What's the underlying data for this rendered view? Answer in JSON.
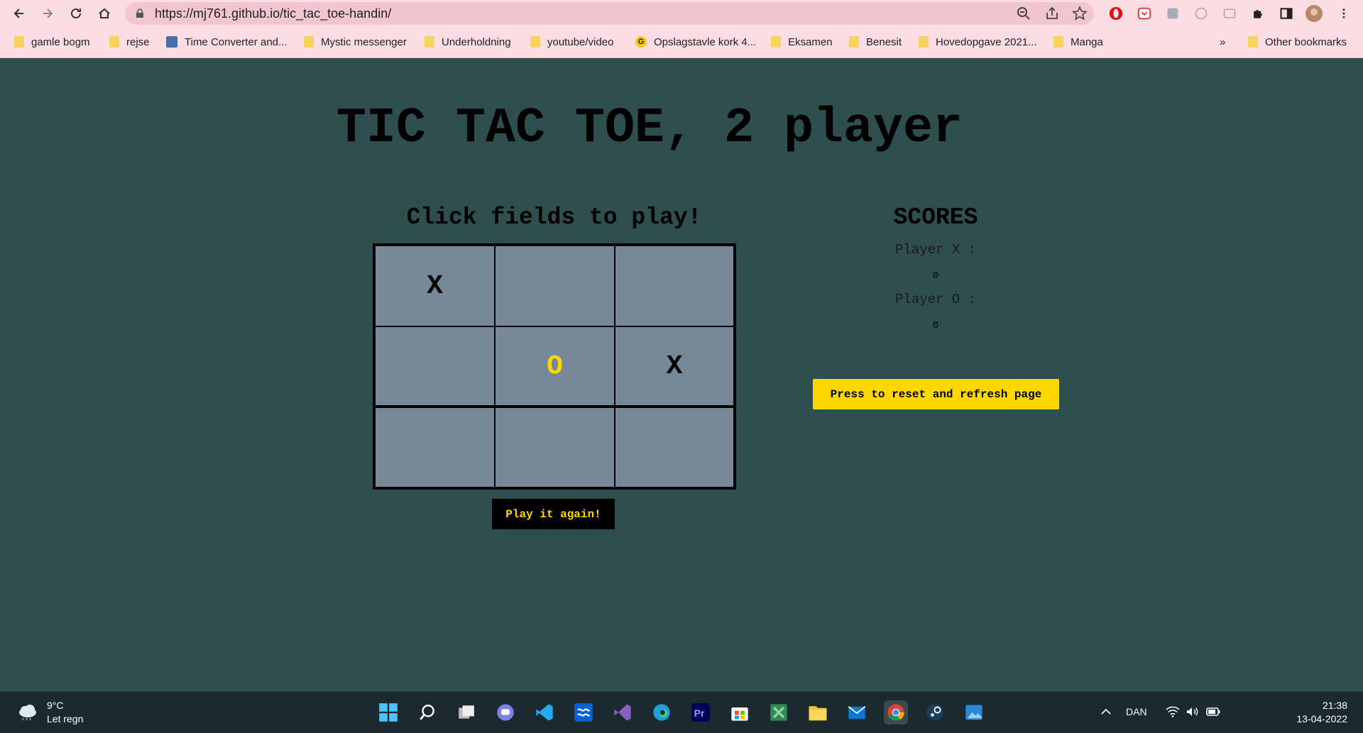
{
  "browser": {
    "url": "https://mj761.github.io/tic_tac_toe-handin/",
    "bookmarks": [
      {
        "label": "gamle bogm",
        "icon": "folder-icon"
      },
      {
        "label": "rejse",
        "icon": "folder-icon"
      },
      {
        "label": "Time Converter and...",
        "icon": "clock-site-icon"
      },
      {
        "label": "Mystic messenger",
        "icon": "folder-icon"
      },
      {
        "label": "Underholdning",
        "icon": "folder-icon"
      },
      {
        "label": "youtube/video",
        "icon": "folder-icon"
      },
      {
        "label": "Opslagstavle kork 4...",
        "icon": "g-site-icon"
      },
      {
        "label": "Eksamen",
        "icon": "folder-icon"
      },
      {
        "label": "Benesit",
        "icon": "folder-icon"
      },
      {
        "label": "Hovedopgave 2021...",
        "icon": "folder-icon"
      },
      {
        "label": "Manga",
        "icon": "folder-icon"
      }
    ],
    "overflow_label": "»",
    "other_bookmarks": "Other bookmarks"
  },
  "game": {
    "title": "TIC TAC TOE, 2 player",
    "instructions": "Click fields to play!",
    "board": [
      "X",
      "",
      "",
      "",
      "O",
      "X",
      "",
      "",
      ""
    ],
    "x_color": "#000000",
    "o_color": "#ffd700",
    "play_again_label": "Play it again!"
  },
  "scores": {
    "title": "SCORES",
    "player_x_label": "Player X :",
    "player_x_score": "0",
    "player_o_label": "Player O :",
    "player_o_score": "0",
    "reset_label": "Press to reset and refresh page"
  },
  "taskbar": {
    "weather_temp": "9°C",
    "weather_desc": "Let regn",
    "language": "DAN",
    "time": "21:38",
    "date": "13-04-2022"
  },
  "colors": {
    "page_background": "#2f4f4f",
    "cell_background": "#778899",
    "accent": "#ffd700",
    "chrome_background": "#fcdde4"
  }
}
